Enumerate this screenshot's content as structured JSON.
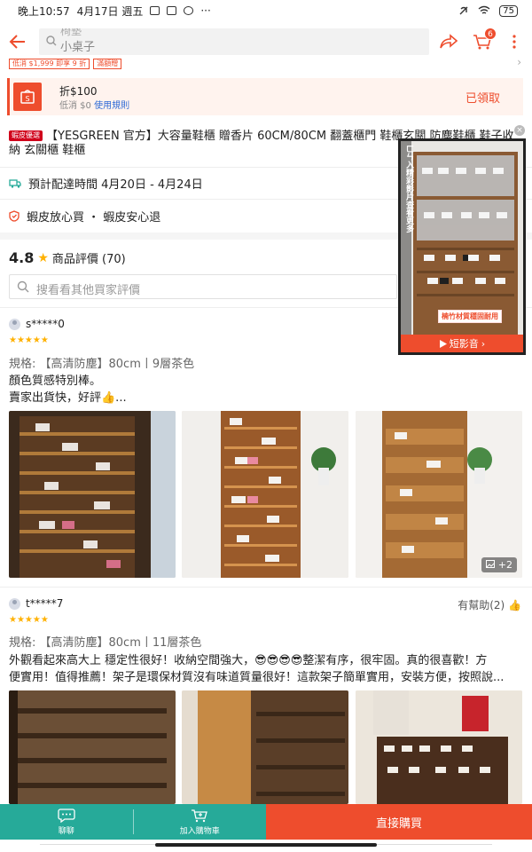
{
  "status_bar": {
    "time": "晚上10:57",
    "date": "4月17日 週五",
    "dots": "···",
    "battery": "75"
  },
  "header": {
    "search_placeholder_line1": "椅墊",
    "search_placeholder_line2": "小桌子",
    "cart_count": "6"
  },
  "promo_strip": [
    "低消 $1,999 即享 9 折",
    "滿額贈"
  ],
  "coupon": {
    "title": "折$100",
    "subtitle": "低消 $0",
    "rules_link": "使用規則",
    "status": "已領取"
  },
  "product": {
    "badge": "蝦皮優選",
    "title": "【YESGREEN 官方】大容量鞋櫃 贈香片 60CM/80CM 翻蓋櫃門 鞋櫃玄關 防塵鞋櫃 鞋子收納 玄關櫃 鞋櫃"
  },
  "shipping": {
    "text": "預計配達時間 4月20日 - 4月24日"
  },
  "guarantee": {
    "text": "蝦皮放心買 ・ 蝦皮安心退"
  },
  "reviews": {
    "score": "4.8",
    "label": "商品評價 (70)",
    "search_placeholder": "搜看看其他買家評價",
    "items": [
      {
        "user": "s*****0",
        "stars": "★★★★★",
        "variant": "規格: 【高清防塵】80cm丨9層茶色",
        "text_line1": "顏色質感特別棒。",
        "text_line2": "賣家出貨快，好評👍...",
        "more_photos": "+2"
      },
      {
        "user": "t*****7",
        "stars": "★★★★★",
        "helpful": "有幫助(2)",
        "variant": "規格: 【高清防塵】80cm丨11層茶色",
        "text_line1": "外觀看起來高大上 穩定性很好！收納空間強大，😎😎😎😎整潔有序，很牢固。真的很喜歡！方",
        "text_line2": "便實用！值得推薦！架子是環保材質沒有味道質量很好！這款架子簡單實用，安裝方便，按照說..."
      }
    ]
  },
  "video": {
    "cta": "短影音",
    "caption": "楠竹材質穩固耐用",
    "side_text": "ㄈㄣ入精彩影片查看更多"
  },
  "bottom_bar": {
    "chat": "聊聊",
    "add_to_cart": "加入購物車",
    "buy_now": "直接購買"
  },
  "colors": {
    "accent": "#ee4d2d",
    "teal": "#26aa99",
    "star": "#ffb100"
  }
}
